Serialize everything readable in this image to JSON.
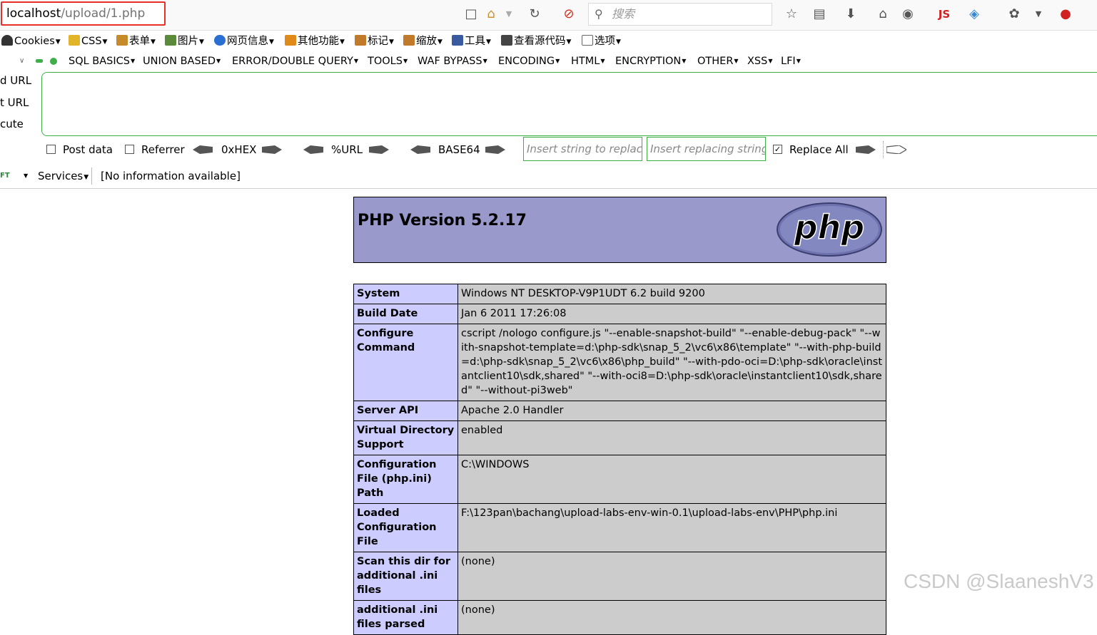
{
  "navbar": {
    "url_host": "localhost",
    "url_path": "/upload/1.php",
    "search_placeholder": "搜索",
    "js_label": "JS"
  },
  "bookmarks": [
    {
      "label": "Cookies",
      "icon": "person-icon",
      "color": "#333333"
    },
    {
      "label": "CSS",
      "icon": "pencil-icon",
      "color": "#e2b42a"
    },
    {
      "label": "表单",
      "icon": "form-icon",
      "color": "#c58a2a"
    },
    {
      "label": "图片",
      "icon": "image-icon",
      "color": "#5a8a3a"
    },
    {
      "label": "网页信息",
      "icon": "info-icon",
      "color": "#2a6fd1"
    },
    {
      "label": "其他功能",
      "icon": "misc-icon",
      "color": "#e08a1a"
    },
    {
      "label": "标记",
      "icon": "mark-icon",
      "color": "#c07a2a"
    },
    {
      "label": "缩放",
      "icon": "zoom-icon",
      "color": "#c07a2a"
    },
    {
      "label": "工具",
      "icon": "tools-icon",
      "color": "#3a5aa0"
    },
    {
      "label": "查看源代码",
      "icon": "source-icon",
      "color": "#444444"
    },
    {
      "label": "选项",
      "icon": "options-icon",
      "color": "#666666"
    }
  ],
  "hackbar": {
    "menu": [
      "SQL BASICS",
      "UNION BASED",
      "ERROR/DOUBLE QUERY",
      "TOOLS",
      "WAF BYPASS",
      "ENCODING",
      "HTML",
      "ENCRYPTION",
      "OTHER",
      "XSS",
      "LFI"
    ],
    "side_labels": [
      "d URL",
      "t URL",
      "cute"
    ],
    "post_data": "Post data",
    "referrer": "Referrer",
    "hex": "0xHEX",
    "url": "%URL",
    "base64": "BASE64",
    "replace_placeholder": "Insert string to replace",
    "replacing_placeholder": "Insert replacing string",
    "replace_all": "Replace All",
    "replace_all_checked": true
  },
  "statusbar": {
    "ft_label": "FT",
    "services": "Services",
    "info": "[No information available]"
  },
  "phpinfo": {
    "title": "PHP Version 5.2.17",
    "logo_text": "php",
    "rows": [
      {
        "key": "System",
        "value": "Windows NT DESKTOP-V9P1UDT 6.2 build 9200"
      },
      {
        "key": "Build Date",
        "value": "Jan 6 2011 17:26:08"
      },
      {
        "key": "Configure Command",
        "value": "cscript /nologo configure.js \"--enable-snapshot-build\" \"--enable-debug-pack\" \"--with-snapshot-template=d:\\php-sdk\\snap_5_2\\vc6\\x86\\template\" \"--with-php-build=d:\\php-sdk\\snap_5_2\\vc6\\x86\\php_build\" \"--with-pdo-oci=D:\\php-sdk\\oracle\\instantclient10\\sdk,shared\" \"--with-oci8=D:\\php-sdk\\oracle\\instantclient10\\sdk,shared\" \"--without-pi3web\""
      },
      {
        "key": "Server API",
        "value": "Apache 2.0 Handler"
      },
      {
        "key": "Virtual Directory Support",
        "value": "enabled"
      },
      {
        "key": "Configuration File (php.ini) Path",
        "value": "C:\\WINDOWS"
      },
      {
        "key": "Loaded Configuration File",
        "value": "F:\\123pan\\bachang\\upload-labs-env-win-0.1\\upload-labs-env\\PHP\\php.ini"
      },
      {
        "key": "Scan this dir for additional .ini files",
        "value": "(none)"
      },
      {
        "key": "additional .ini files parsed",
        "value": "(none)"
      }
    ]
  },
  "watermark": "CSDN @SlaaneshV3",
  "colors": {
    "url_highlight": "#e8302a",
    "hackbar_green": "#3fae49",
    "php_header": "#9999cc",
    "php_key": "#ccccff",
    "php_value": "#cccccc"
  }
}
